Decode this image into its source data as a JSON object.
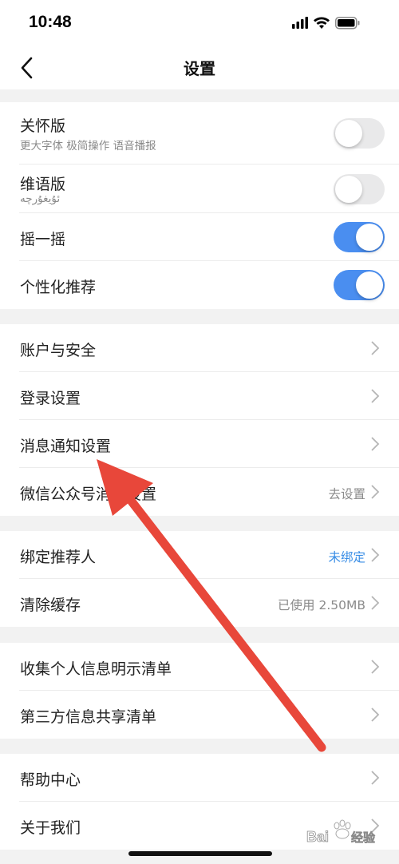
{
  "status_bar": {
    "time": "10:48"
  },
  "nav": {
    "title": "设置"
  },
  "groups": [
    {
      "rows": [
        {
          "title": "关怀版",
          "subtitle": "更大字体 极简操作 语音播报",
          "toggle": "off"
        },
        {
          "title": "维语版",
          "subtitle": "ئۇيغۇرچە",
          "toggle": "off"
        },
        {
          "title": "摇一摇",
          "toggle": "on"
        },
        {
          "title": "个性化推荐",
          "toggle": "on"
        }
      ]
    },
    {
      "rows": [
        {
          "title": "账户与安全"
        },
        {
          "title": "登录设置"
        },
        {
          "title": "消息通知设置"
        },
        {
          "title": "微信公众号消息设置",
          "value": "去设置"
        }
      ]
    },
    {
      "rows": [
        {
          "title": "绑定推荐人",
          "value": "未绑定"
        },
        {
          "title": "清除缓存",
          "value": "已使用 2.50MB"
        }
      ]
    },
    {
      "rows": [
        {
          "title": "收集个人信息明示清单"
        },
        {
          "title": "第三方信息共享清单"
        }
      ]
    },
    {
      "rows": [
        {
          "title": "帮助中心"
        },
        {
          "title": "关于我们"
        }
      ]
    }
  ],
  "colors": {
    "toggle_on": "#4a8ef0",
    "accent_value": "#3a8ee6",
    "annotation_arrow": "#e8473a"
  },
  "icons": [
    "signal-icon",
    "wifi-icon",
    "battery-icon",
    "back-chevron-icon",
    "chevron-right-icon"
  ],
  "watermark": "Baidu经验"
}
